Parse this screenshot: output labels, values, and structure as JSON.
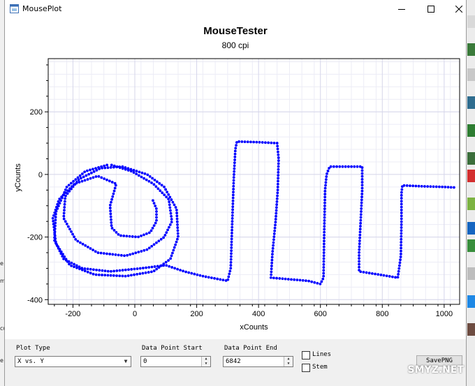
{
  "window": {
    "title": "MousePlot"
  },
  "background": {
    "left_labels": [
      "e",
      "m",
      "cu",
      "e"
    ]
  },
  "chart_data": {
    "type": "scatter",
    "title": "MouseTester",
    "subtitle": "800 cpi",
    "xlabel": "xCounts",
    "ylabel": "yCounts",
    "xlim": [
      -280,
      1050
    ],
    "ylim": [
      -415,
      370
    ],
    "xticks": [
      -200,
      0,
      200,
      400,
      600,
      800,
      1000
    ],
    "yticks": [
      -400,
      -200,
      0,
      200
    ],
    "grid": true,
    "marker_color": "#0000ff",
    "strokes": [
      {
        "name": "",
        "points": [
          [
            -75,
            30
          ],
          [
            -10,
            10
          ],
          [
            60,
            -30
          ],
          [
            110,
            -80
          ],
          [
            120,
            -150
          ],
          [
            95,
            -200
          ],
          [
            40,
            -240
          ],
          [
            -30,
            -260
          ],
          [
            -120,
            -250
          ],
          [
            -190,
            -210
          ],
          [
            -230,
            -140
          ],
          [
            -225,
            -70
          ],
          [
            -180,
            -15
          ],
          [
            -110,
            20
          ],
          [
            -40,
            25
          ],
          [
            40,
            0
          ],
          [
            95,
            -40
          ],
          [
            135,
            -110
          ],
          [
            140,
            -200
          ],
          [
            115,
            -270
          ],
          [
            60,
            -310
          ],
          [
            -30,
            -325
          ],
          [
            -130,
            -320
          ],
          [
            -210,
            -290
          ],
          [
            -255,
            -220
          ],
          [
            -265,
            -140
          ],
          [
            -245,
            -80
          ],
          [
            -195,
            -30
          ],
          [
            -120,
            -5
          ],
          [
            -60,
            -30
          ],
          [
            -80,
            -100
          ],
          [
            -75,
            -170
          ],
          [
            -50,
            -195
          ],
          [
            10,
            -200
          ],
          [
            50,
            -185
          ],
          [
            70,
            -150
          ],
          [
            70,
            -110
          ],
          [
            55,
            -75
          ]
        ]
      },
      {
        "name": "",
        "points": [
          [
            -90,
            30
          ],
          [
            -160,
            10
          ],
          [
            -220,
            -40
          ],
          [
            -255,
            -120
          ],
          [
            -260,
            -210
          ],
          [
            -230,
            -270
          ],
          [
            -170,
            -300
          ],
          [
            -80,
            -310
          ],
          [
            20,
            -300
          ],
          [
            100,
            -290
          ],
          [
            160,
            -310
          ],
          [
            220,
            -325
          ],
          [
            300,
            -340
          ],
          [
            310,
            -300
          ],
          [
            315,
            -150
          ],
          [
            320,
            -10
          ],
          [
            325,
            80
          ],
          [
            330,
            105
          ],
          [
            400,
            103
          ],
          [
            460,
            100
          ],
          [
            465,
            50
          ],
          [
            462,
            -50
          ],
          [
            455,
            -150
          ],
          [
            445,
            -250
          ],
          [
            440,
            -330
          ],
          [
            500,
            -335
          ],
          [
            560,
            -340
          ],
          [
            600,
            -350
          ],
          [
            610,
            -330
          ],
          [
            612,
            -200
          ],
          [
            615,
            -50
          ],
          [
            620,
            0
          ],
          [
            630,
            25
          ],
          [
            700,
            25
          ],
          [
            735,
            25
          ],
          [
            735,
            -50
          ],
          [
            730,
            -150
          ],
          [
            725,
            -250
          ],
          [
            725,
            -310
          ],
          [
            790,
            -320
          ],
          [
            850,
            -330
          ],
          [
            860,
            -260
          ],
          [
            862,
            -150
          ],
          [
            862,
            -60
          ],
          [
            865,
            -35
          ],
          [
            930,
            -38
          ],
          [
            1000,
            -40
          ],
          [
            1040,
            -42
          ]
        ]
      }
    ],
    "legend": "none"
  },
  "controls": {
    "plot_type": {
      "label": "Plot Type",
      "value": "X vs. Y"
    },
    "data_point_start": {
      "label": "Data Point Start",
      "value": "0"
    },
    "data_point_end": {
      "label": "Data Point End",
      "value": "6842"
    },
    "lines": {
      "label": "Lines",
      "checked": false
    },
    "stem": {
      "label": "Stem",
      "checked": false
    },
    "save_button": "SavePNG"
  },
  "watermark": "SMYZ.NET"
}
